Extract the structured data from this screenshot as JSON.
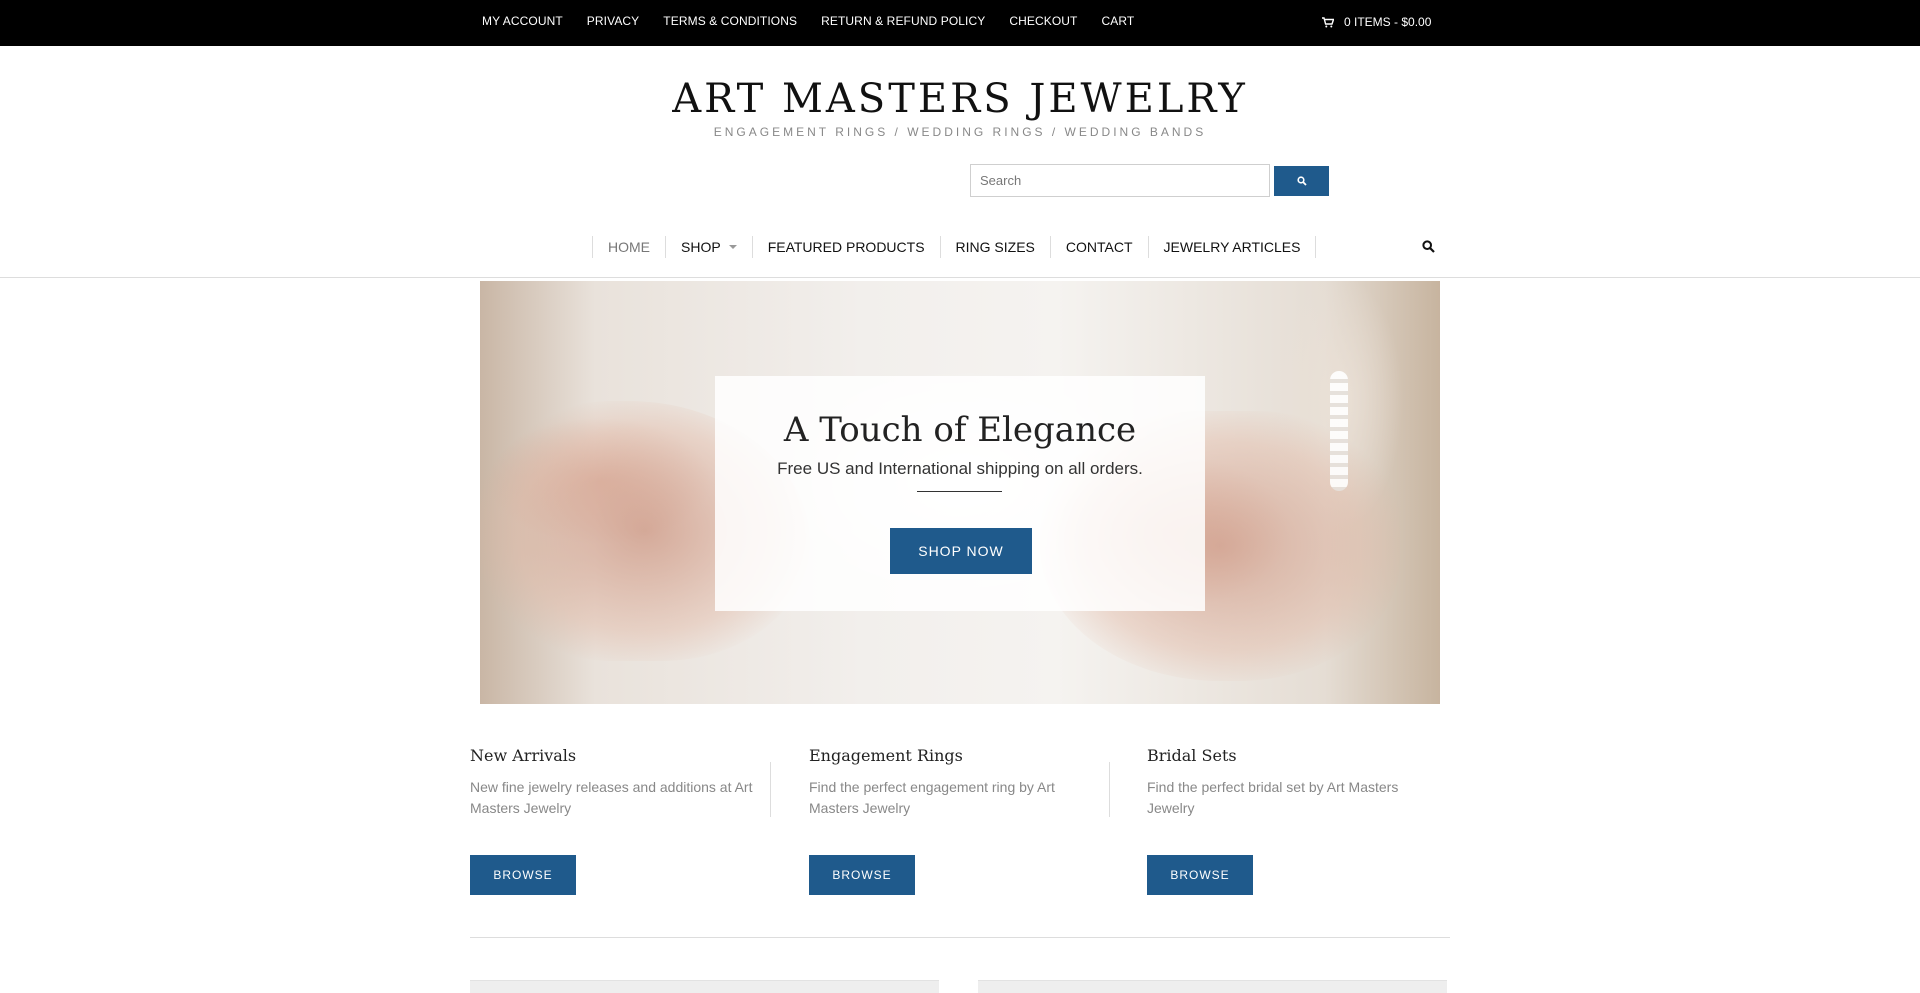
{
  "topbar": {
    "links": [
      "MY ACCOUNT",
      "PRIVACY",
      "TERMS & CONDITIONS",
      "RETURN & REFUND POLICY",
      "CHECKOUT",
      "CART"
    ],
    "cart_summary": "0 ITEMS - $0.00",
    "cart_icon": "shopping-cart-icon"
  },
  "header": {
    "logo": "ART MASTERS JEWELRY",
    "tagline": "ENGAGEMENT RINGS / WEDDING RINGS / WEDDING BANDS"
  },
  "search": {
    "placeholder": "Search",
    "button_icon": "search-icon"
  },
  "nav": {
    "items": [
      "HOME",
      "SHOP",
      "FEATURED PRODUCTS",
      "RING SIZES",
      "CONTACT",
      "JEWELRY ARTICLES"
    ],
    "search_icon": "search-icon"
  },
  "hero": {
    "title": "A Touch of Elegance",
    "subtitle": "Free US and International shipping on all orders.",
    "button": "SHOP NOW"
  },
  "categories": [
    {
      "title": "New Arrivals",
      "description": "New fine jewelry releases and additions at Art Masters Jewelry",
      "button": "BROWSE"
    },
    {
      "title": "Engagement Rings",
      "description": "Find the perfect engagement ring by Art Masters Jewelry",
      "button": "BROWSE"
    },
    {
      "title": "Bridal Sets",
      "description": "Find the perfect bridal set by Art Masters Jewelry",
      "button": "BROWSE"
    }
  ],
  "colors": {
    "accent": "#1f5a8c",
    "topbar_bg": "#000000"
  }
}
